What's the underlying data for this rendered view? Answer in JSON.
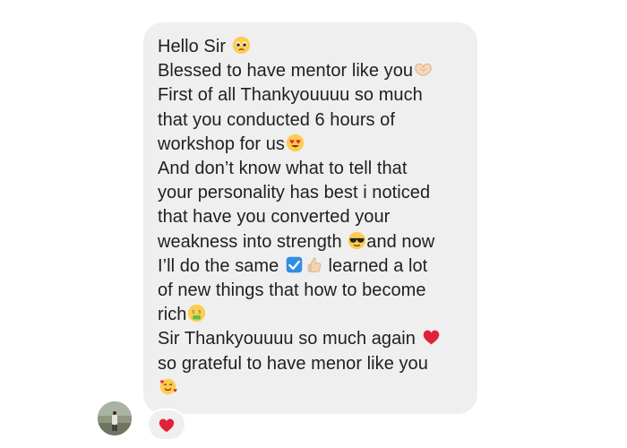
{
  "message": {
    "lines": [
      "Hello Sir",
      "Blessed to have mentor like you",
      "First of all Thankyouuuu so much",
      "that you conducted 6 hours of",
      "workshop for us",
      "And don’t know what to tell that",
      "your personality has best i noticed",
      "that have you converted your",
      "weakness into strength",
      "and now",
      "I’ll do the same",
      "learned a lot",
      "of new things that how to become",
      "rich",
      "Sir Thankyouuuu so much again",
      "so grateful to have menor like you"
    ],
    "emojis": [
      "pleading-face-emoji",
      "heart-hands-emoji",
      "heart-eyes-emoji",
      "sunglasses-emoji",
      "check-mark-button-emoji",
      "thumbs-up-emoji",
      "money-mouth-emoji",
      "red-heart-emoji",
      "smiling-face-with-hearts-emoji"
    ]
  },
  "reaction": {
    "icon": "red-heart-icon",
    "color": "#e0233a"
  },
  "colors": {
    "bubble_bg": "#efefef",
    "text": "#1f1f1f",
    "page_bg": "#ffffff"
  }
}
